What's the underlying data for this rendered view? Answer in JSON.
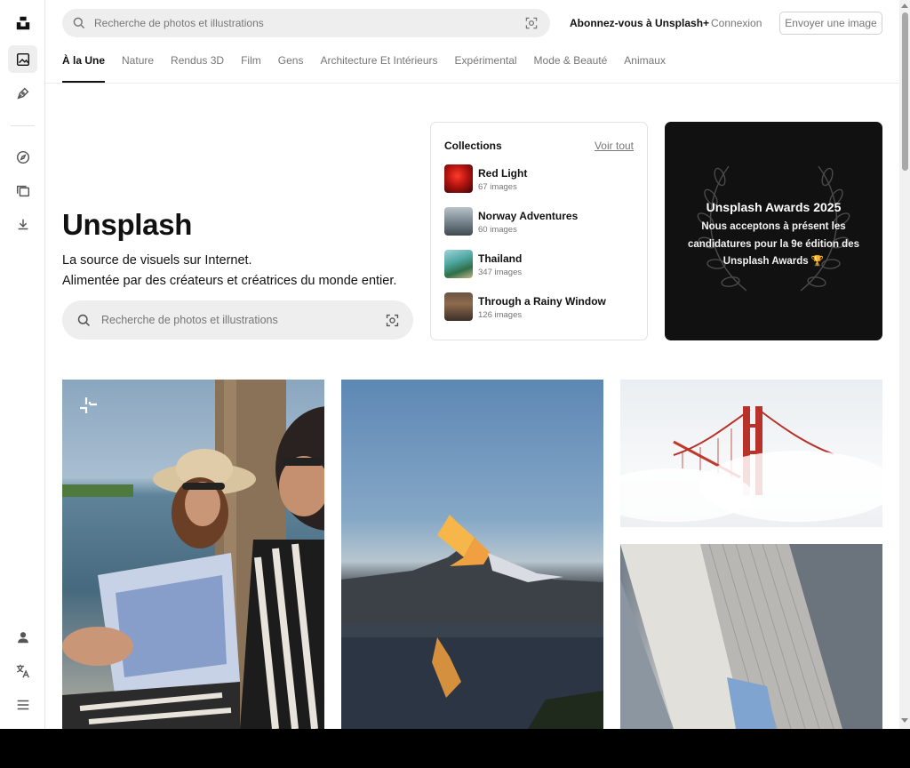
{
  "search": {
    "placeholder": "Recherche de photos et illustrations"
  },
  "header": {
    "subscribe_label": "Abonnez-vous à Unsplash+",
    "login_label": "Connexion",
    "upload_label": "Envoyer une image"
  },
  "tabs": [
    {
      "label": "À la Une",
      "active": true
    },
    {
      "label": "Nature"
    },
    {
      "label": "Rendus 3D"
    },
    {
      "label": "Film"
    },
    {
      "label": "Gens"
    },
    {
      "label": "Architecture Et Intérieurs"
    },
    {
      "label": "Expérimental"
    },
    {
      "label": "Mode & Beauté"
    },
    {
      "label": "Animaux"
    }
  ],
  "hero": {
    "title": "Unsplash",
    "line1": "La source de visuels sur Internet.",
    "line2": "Alimentée par des créateurs et créatrices du monde entier.",
    "search_placeholder": "Recherche de photos et illustrations"
  },
  "collections": {
    "title": "Collections",
    "see_all": "Voir tout",
    "items": [
      {
        "name": "Red Light",
        "count": "67 images",
        "color": "#b3140f"
      },
      {
        "name": "Norway Adventures",
        "count": "60 images",
        "color": "#6a7a86"
      },
      {
        "name": "Thailand",
        "count": "347 images",
        "color": "#5fa3a0"
      },
      {
        "name": "Through a Rainy Window",
        "count": "126 images",
        "color": "#7a5a44"
      }
    ]
  },
  "awards": {
    "title": "Unsplash Awards 2025",
    "body": "Nous acceptons à présent les candidatures pour la 9e édition des Unsplash Awards 🏆"
  },
  "colors": {
    "primary_text": "#111111",
    "secondary_text": "#767676",
    "search_bg": "#eeeeee",
    "awards_bg": "#111111"
  }
}
